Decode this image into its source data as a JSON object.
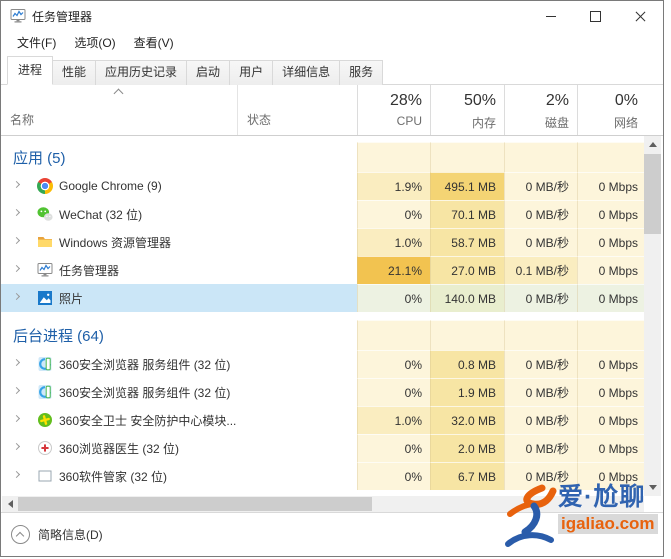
{
  "window": {
    "title": "任务管理器"
  },
  "menu": {
    "items": [
      {
        "id": "file",
        "label": "文件(F)"
      },
      {
        "id": "options",
        "label": "选项(O)"
      },
      {
        "id": "view",
        "label": "查看(V)"
      }
    ]
  },
  "tabs": {
    "active_id": "processes",
    "items": [
      {
        "id": "processes",
        "label": "进程"
      },
      {
        "id": "performance",
        "label": "性能"
      },
      {
        "id": "app-history",
        "label": "应用历史记录"
      },
      {
        "id": "startup",
        "label": "启动"
      },
      {
        "id": "users",
        "label": "用户"
      },
      {
        "id": "details",
        "label": "详细信息"
      },
      {
        "id": "services",
        "label": "服务"
      }
    ]
  },
  "table": {
    "name_header": "名称",
    "status_header": "状态",
    "usage_headers": [
      {
        "id": "cpu",
        "pct": "28%",
        "label": "CPU"
      },
      {
        "id": "memory",
        "pct": "50%",
        "label": "内存"
      },
      {
        "id": "disk",
        "pct": "2%",
        "label": "磁盘"
      },
      {
        "id": "network",
        "pct": "0%",
        "label": "网络"
      }
    ],
    "groups": [
      {
        "label": "应用 (5)",
        "rows": [
          {
            "name": "Google Chrome (9)",
            "icon": "chrome-icon",
            "cpu": "1.9%",
            "memory": "495.1 MB",
            "disk": "0 MB/秒",
            "network": "0 Mbps",
            "heat": [
              1,
              3,
              0,
              0
            ],
            "selected": false
          },
          {
            "name": "WeChat (32 位)",
            "icon": "wechat-icon",
            "cpu": "0%",
            "memory": "70.1 MB",
            "disk": "0 MB/秒",
            "network": "0 Mbps",
            "heat": [
              0,
              2,
              0,
              0
            ],
            "selected": false
          },
          {
            "name": "Windows 资源管理器",
            "icon": "explorer-icon",
            "cpu": "1.0%",
            "memory": "58.7 MB",
            "disk": "0 MB/秒",
            "network": "0 Mbps",
            "heat": [
              1,
              2,
              0,
              0
            ],
            "selected": false
          },
          {
            "name": "任务管理器",
            "icon": "task-manager-icon",
            "cpu": "21.1%",
            "memory": "27.0 MB",
            "disk": "0.1 MB/秒",
            "network": "0 Mbps",
            "heat": [
              4,
              2,
              1,
              0
            ],
            "selected": false
          },
          {
            "name": "照片",
            "icon": "photos-icon",
            "cpu": "0%",
            "memory": "140.0 MB",
            "disk": "0 MB/秒",
            "network": "0 Mbps",
            "heat": [
              0,
              2,
              0,
              0
            ],
            "selected": true
          }
        ]
      },
      {
        "label": "后台进程 (64)",
        "rows": [
          {
            "name": "360安全浏览器 服务组件 (32 位)",
            "icon": "browser360-icon",
            "cpu": "0%",
            "memory": "0.8 MB",
            "disk": "0 MB/秒",
            "network": "0 Mbps",
            "heat": [
              0,
              2,
              0,
              0
            ],
            "selected": false
          },
          {
            "name": "360安全浏览器 服务组件 (32 位)",
            "icon": "browser360-icon",
            "cpu": "0%",
            "memory": "1.9 MB",
            "disk": "0 MB/秒",
            "network": "0 Mbps",
            "heat": [
              0,
              2,
              0,
              0
            ],
            "selected": false
          },
          {
            "name": "360安全卫士 安全防护中心模块...",
            "icon": "safe360-icon",
            "cpu": "1.0%",
            "memory": "32.0 MB",
            "disk": "0 MB/秒",
            "network": "0 Mbps",
            "heat": [
              1,
              2,
              0,
              0
            ],
            "selected": false
          },
          {
            "name": "360浏览器医生 (32 位)",
            "icon": "doctor360-icon",
            "cpu": "0%",
            "memory": "2.0 MB",
            "disk": "0 MB/秒",
            "network": "0 Mbps",
            "heat": [
              0,
              2,
              0,
              0
            ],
            "selected": false
          },
          {
            "name": "360软件管家 (32 位)",
            "icon": "manager360-icon",
            "cpu": "0%",
            "memory": "6.7 MB",
            "disk": "0 MB/秒",
            "network": "0 Mbps",
            "heat": [
              0,
              2,
              0,
              0
            ],
            "selected": false
          }
        ]
      }
    ]
  },
  "footer": {
    "details_label": "简略信息(D)"
  },
  "watermark": {
    "title": "爱·尬聊",
    "site": "igaliao.com"
  },
  "colors": {
    "heat_palette": [
      "#FDF5DB",
      "#FAEDC0",
      "#F7E5A4",
      "#F4D474",
      "#F2C350"
    ],
    "selected_row": "#CBE6F7",
    "selected_heat": "#EDF2E2",
    "selected_heat_memory": "#E9EECE",
    "group_label": "#1E5FA8",
    "watermark_blue": "#3063B0",
    "watermark_orange": "#E8620D"
  }
}
